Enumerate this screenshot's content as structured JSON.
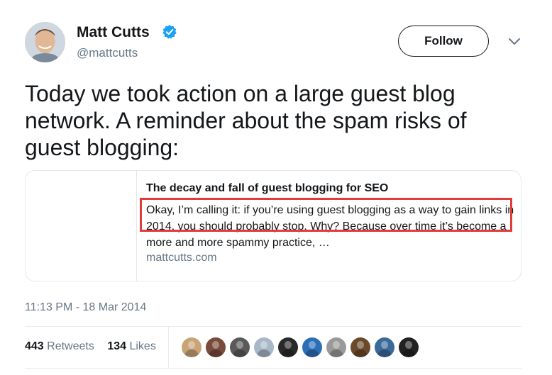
{
  "author": {
    "name": "Matt Cutts",
    "handle": "@mattcutts",
    "verified_color": "#1da1f2"
  },
  "actions": {
    "follow_label": "Follow"
  },
  "tweet": {
    "text": "Today we took action on a large guest blog network. A reminder about the spam risks of guest blogging:"
  },
  "card": {
    "title": "The decay and fall of guest blogging for SEO",
    "description": "Okay, I’m calling it: if you’re using guest blogging as a way to gain links in 2014, you should probably stop. Why? Because over time it’s become a more and more spammy practice, …",
    "domain": "mattcutts.com",
    "highlight_color": "#e03c3c"
  },
  "timestamp": "11:13 PM - 18 Mar 2014",
  "stats": {
    "retweets_count": "443",
    "retweets_label": "Retweets",
    "likes_count": "134",
    "likes_label": "Likes"
  },
  "liker_avatar_colors": [
    "#c9a476",
    "#7a4a3a",
    "#5a5a5a",
    "#a8b8c8",
    "#2a2a2a",
    "#2b6fb8",
    "#9a9a9a",
    "#6a4a2a",
    "#3a6a9a",
    "#222222"
  ]
}
